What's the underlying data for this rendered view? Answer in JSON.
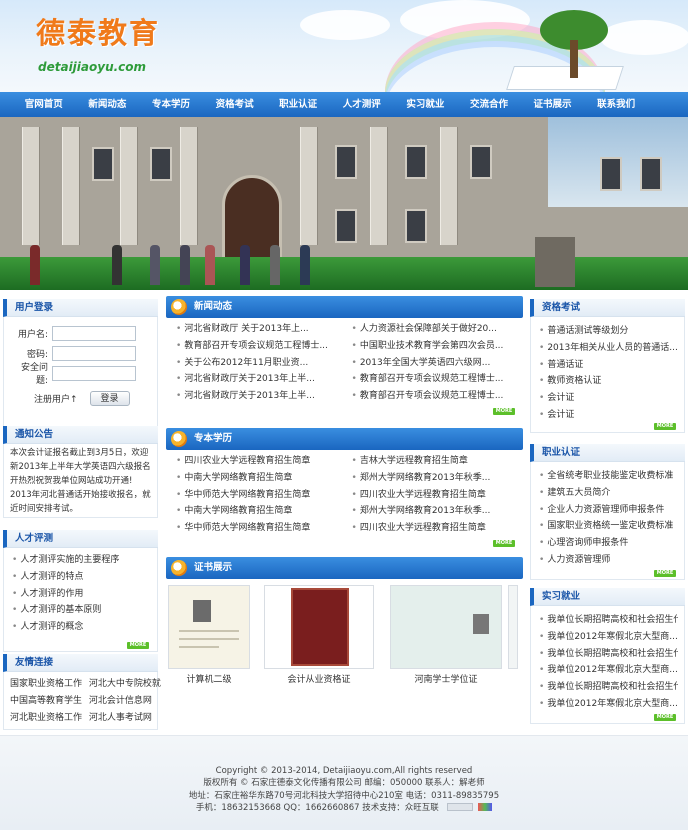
{
  "header": {
    "logo_cn": "德泰教育",
    "logo_en": "detaijiaoyu.com"
  },
  "nav": [
    "官网首页",
    "新闻动态",
    "专本学历",
    "资格考试",
    "职业认证",
    "人才测评",
    "实习就业",
    "交流合作",
    "证书展示",
    "联系我们"
  ],
  "login": {
    "title": "用户登录",
    "username_label": "用户名:",
    "password_label": "密码:",
    "security_label": "安全问题:",
    "register_label": "注册用户↑",
    "login_button": "登录"
  },
  "notice": {
    "title": "通知公告",
    "text1": "本次会计证报名截止到3月5日，欢迎新2013年上半年大学英语四六级报名开热烈祝贺我单位网站成功开通!",
    "text2": "2013年河北普通话开始接收报名，就近时间安排考试。"
  },
  "talent": {
    "title": "人才评测",
    "items": [
      "人才测评实施的主要程序",
      "人才测评的特点",
      "人才测评的作用",
      "人才测评的基本原则",
      "人才测评的概念"
    ],
    "more": "MORE"
  },
  "friends": {
    "title": "友情连接",
    "links": [
      [
        "国家职业资格工作",
        "河北大中专院校就"
      ],
      [
        "中国高等教育学生",
        "河北会计信息网"
      ],
      [
        "河北职业资格工作",
        "河北人事考试网"
      ]
    ]
  },
  "news": {
    "title": "新闻动态",
    "left": [
      "河北省财政厅 关于2013年上...",
      "教育部召开专项会议规范工程博士...",
      "关于公布2012年11月职业资...",
      "河北省财政厅关于2013年上半...",
      "河北省财政厅关于2013年上半..."
    ],
    "right": [
      "人力资源社会保障部关于做好20...",
      "中国职业技术教育学会第四次会员...",
      "2013年全国大学英语四六级网...",
      "教育部召开专项会议规范工程博士...",
      "教育部召开专项会议规范工程博士..."
    ],
    "more": "MORE"
  },
  "degree": {
    "title": "专本学历",
    "left": [
      "四川农业大学远程教育招生简章",
      "中南大学网络教育招生简章",
      "华中师范大学网络教育招生简章",
      "中南大学网络教育招生简章",
      "华中师范大学网络教育招生简章"
    ],
    "right": [
      "吉林大学远程教育招生简章",
      "郑州大学网络教育2013年秋季...",
      "四川农业大学远程教育招生简章",
      "郑州大学网络教育2013年秋季...",
      "四川农业大学远程教育招生简章"
    ],
    "more": "MORE"
  },
  "certs": {
    "title": "证书展示",
    "items": [
      "计算机二级",
      "会计从业资格证",
      "河南学士学位证"
    ]
  },
  "exams": {
    "title": "资格考试",
    "items": [
      "普通话测试等级划分",
      "2013年相关从业人员的普通话...",
      "普通话证",
      "教师资格认证",
      "会计证",
      "会计证"
    ],
    "more": "MORE"
  },
  "cert_auth": {
    "title": "职业认证",
    "items": [
      "全省统考职业技能鉴定收费标准",
      "建筑五大员简介",
      "企业人力资源管理师申报条件",
      "国家职业资格统一鉴定收费标准",
      "心理咨询师申报条件",
      "人力资源管理师"
    ],
    "more": "MORE"
  },
  "jobs": {
    "title": "实习就业",
    "items": [
      "我单位长期招聘高校和社会招生代...",
      "我单位2012年寒假北京大型商...",
      "我单位长期招聘高校和社会招生代...",
      "我单位2012年寒假北京大型商...",
      "我单位长期招聘高校和社会招生代...",
      "我单位2012年寒假北京大型商..."
    ],
    "more": "MORE"
  },
  "footer": {
    "line1": "Copyright © 2013-2014, Detaijiaoyu.com,All rights reserved",
    "line2": "版权所有 © 石家庄德泰文化传播有限公司    邮编：050000    联系人：解老师",
    "line3": "地址：石家庄裕华东路70号河北科技大学招待中心210室    电话：0311-89835795",
    "line4": "手机：18632153668    QQ：1662660867    技术支持：众旺互联"
  }
}
